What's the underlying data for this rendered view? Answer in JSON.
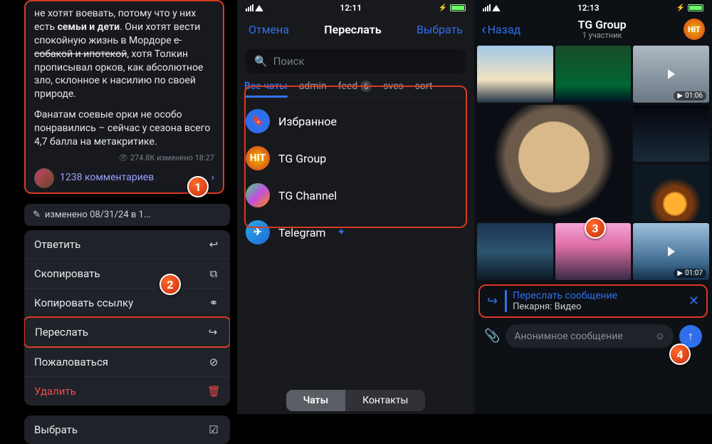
{
  "panel1": {
    "message": {
      "part1": "не хотят воевать, потому что у них есть ",
      "bold": "семьи и дети",
      "part2": ". Они хотят вести спокойную жизнь в Мордоре ",
      "strike": "с собакой и ипотекой",
      "part3": ", хотя Толкин прописывал орков, как абсолютное зло, склонное к насилию по своей природе.",
      "para2": "Фанатам соевые орки не особо понравились – сейчас у сезона всего 4,7 балла на метакритике.",
      "views": "274.8K",
      "edited": "изменено",
      "time": "18:27",
      "comments": "1238 комментариев"
    },
    "edited_chip": "изменено 08/31/24 в 1...",
    "menu": {
      "reply": "Ответить",
      "copy": "Скопировать",
      "copy_link": "Копировать ссылку",
      "forward": "Переслать",
      "report": "Пожаловаться",
      "delete": "Удалить",
      "select": "Выбрать"
    },
    "badges": {
      "b1": "1",
      "b2": "2"
    }
  },
  "panel2": {
    "status_time": "12:11",
    "cancel": "Отмена",
    "title": "Переслать",
    "select": "Выбрать",
    "search_placeholder": "Поиск",
    "tabs": {
      "all": "Все чаты",
      "admin": "admin",
      "feed": "feed",
      "feed_badge": "6",
      "svcs": "svcs",
      "sort": "sort"
    },
    "chats": {
      "saved": "Избранное",
      "group": "TG Group",
      "channel": "TG Channel",
      "telegram": "Telegram"
    },
    "segments": {
      "chats": "Чаты",
      "contacts": "Контакты"
    },
    "badge": "3"
  },
  "panel3": {
    "status_time": "12:13",
    "back": "Назад",
    "title": "TG Group",
    "subtitle": "1 участник",
    "durations": {
      "d1": "01:06",
      "d2": "01:07"
    },
    "forward": {
      "title": "Переслать сообщение",
      "subtitle": "Пекарня: Видео"
    },
    "input_placeholder": "Анонимное сообщение",
    "badge": "4"
  }
}
